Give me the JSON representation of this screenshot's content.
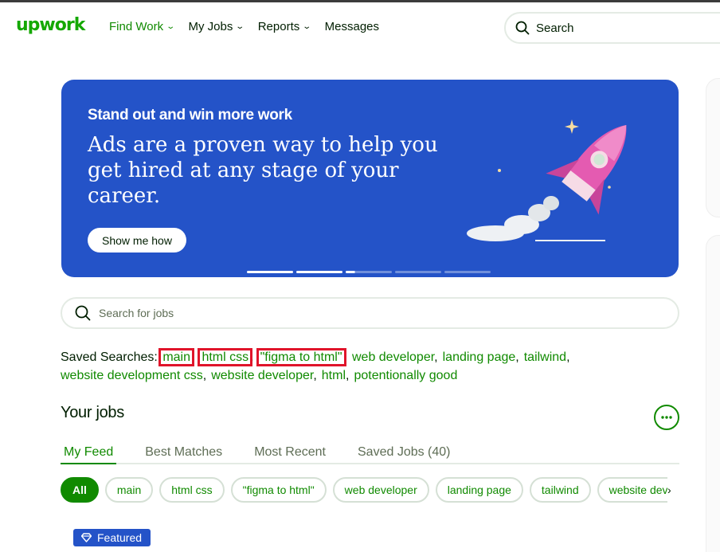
{
  "brand": {
    "logo": "upwork",
    "accent": "#108a00",
    "logo_color": "#14a800"
  },
  "nav": {
    "items": [
      {
        "label": "Find Work",
        "dropdown": true,
        "active": true
      },
      {
        "label": "My Jobs",
        "dropdown": true
      },
      {
        "label": "Reports",
        "dropdown": true
      },
      {
        "label": "Messages",
        "dropdown": false
      }
    ]
  },
  "top_search": {
    "label": "Search"
  },
  "banner": {
    "eyebrow": "Stand out and win more work",
    "headline": "Ads are a proven way to help you get hired at any stage of your career.",
    "cta": "Show me how",
    "background": "#2453c8"
  },
  "job_search": {
    "placeholder": "Search for jobs"
  },
  "saved_searches": {
    "label": "Saved Searches:",
    "items": [
      "main",
      "html css",
      "\"figma to html\"",
      "web developer",
      "landing page",
      "tailwind",
      "website development css",
      "website developer",
      "html",
      "potentionally good"
    ]
  },
  "your_jobs": {
    "title": "Your jobs",
    "more_icon": "ellipsis-icon"
  },
  "tabs": [
    "My Feed",
    "Best Matches",
    "Most Recent",
    "Saved Jobs (40)"
  ],
  "chips": [
    "All",
    "main",
    "html css",
    "\"figma to html\"",
    "web developer",
    "landing page",
    "tailwind",
    "website deve"
  ],
  "featured_badge": {
    "label": "Featured",
    "icon": "diamond-icon",
    "color": "#2453c8"
  },
  "highlight_color": "#e0142a"
}
